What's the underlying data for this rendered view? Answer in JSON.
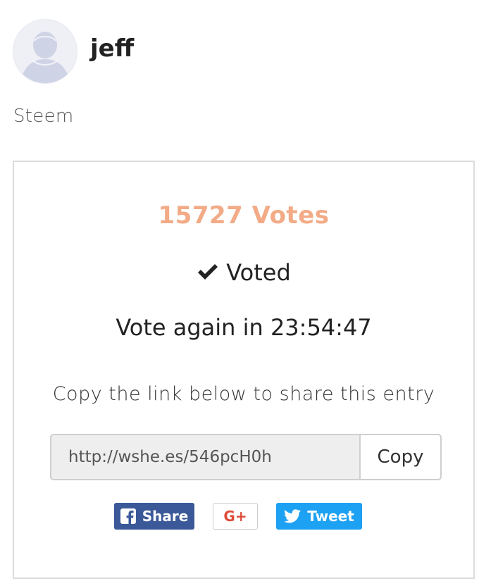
{
  "user": {
    "name": "jeff",
    "avatar_icon": "default-user-avatar"
  },
  "category": "Steem",
  "vote_card": {
    "votes_label": "15727 Votes",
    "votes_color": "#f2ab86",
    "voted_icon": "checkmark-icon",
    "voted_label": "Voted",
    "countdown_label": "Vote again in 23:54:47",
    "share_prompt": "Copy the link below to share this entry",
    "share_link": "http://wshe.es/546pcH0h",
    "copy_label": "Copy"
  },
  "social": {
    "facebook_label": "Share",
    "facebook_color": "#3b5998",
    "googleplus_label": "G+",
    "googleplus_color": "#dd4b39",
    "twitter_label": "Tweet",
    "twitter_color": "#1da1f2"
  }
}
